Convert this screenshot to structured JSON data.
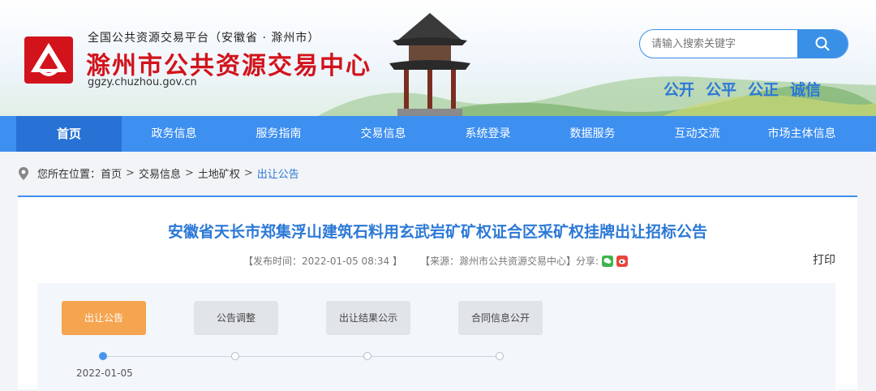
{
  "header": {
    "subtitle": "全国公共资源交易平台（安徽省 · 滁州市）",
    "title": "滁州市公共资源交易中心",
    "domain": "ggzy.chuzhou.gov.cn",
    "search_placeholder": "请输入搜索关键字",
    "slogan": [
      "公开",
      "公平",
      "公正",
      "诚信"
    ]
  },
  "nav": [
    "首页",
    "政务信息",
    "服务指南",
    "交易信息",
    "系统登录",
    "数据服务",
    "互动交流",
    "市场主体信息"
  ],
  "breadcrumb": {
    "prefix": "您所在位置：",
    "items": [
      "首页",
      "交易信息",
      "土地矿权"
    ],
    "separator": ">",
    "current": "出让公告"
  },
  "article": {
    "title": "安徽省天长市郑集浮山建筑石料用玄武岩矿矿权证合区采矿权挂牌出让招标公告",
    "publish_time": "【发布时间：2022-01-05 08:34 】",
    "source": "【来源：滁州市公共资源交易中心】",
    "share_label": "分享:",
    "print_label": "打印"
  },
  "tabs": [
    "出让公告",
    "公告调整",
    "出让结果公示",
    "合同信息公开"
  ],
  "timeline": {
    "date": "2022-01-05"
  },
  "colors": {
    "brand_red": "#d2131b",
    "nav_blue": "#3d8ff0",
    "active_orange": "#f5a44f",
    "title_blue": "#2b78d6"
  }
}
